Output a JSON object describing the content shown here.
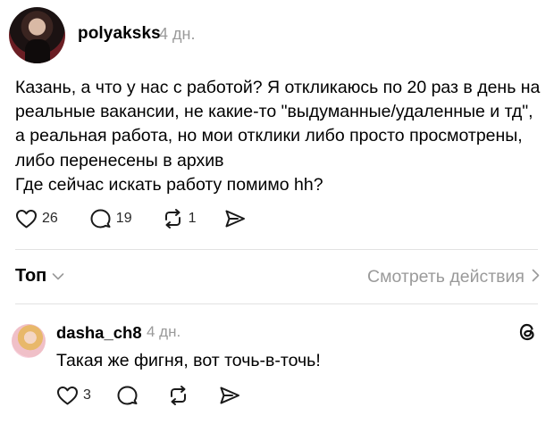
{
  "post": {
    "username": "polyaksks",
    "time": "4 дн.",
    "lines": [
      "Казань, а что у нас с работой? Я откликаюсь по 20 раз в день на",
      "реальные вакансии, не какие-то \"выдуманные/удаленные и тд\",",
      "а реальная работа, но мои отклики либо просто просмотрены,",
      "либо перенесены в архив",
      "Где сейчас искать работу помимо hh?"
    ],
    "likes": "26",
    "replies": "19",
    "reposts": "1"
  },
  "filter": {
    "label": "Топ",
    "view_activity": "Смотреть действия"
  },
  "reply": {
    "username": "dasha_ch8",
    "time": "4 дн.",
    "text": "Такая же фигня, вот точь-в-точь!",
    "likes": "3"
  },
  "icons": {
    "like": "heart-icon",
    "reply": "comment-icon",
    "repost": "repost-icon",
    "share": "send-icon",
    "chevron_down": "chevron-down-icon",
    "chevron_right": "chevron-right-icon",
    "threads": "threads-logo-icon"
  }
}
